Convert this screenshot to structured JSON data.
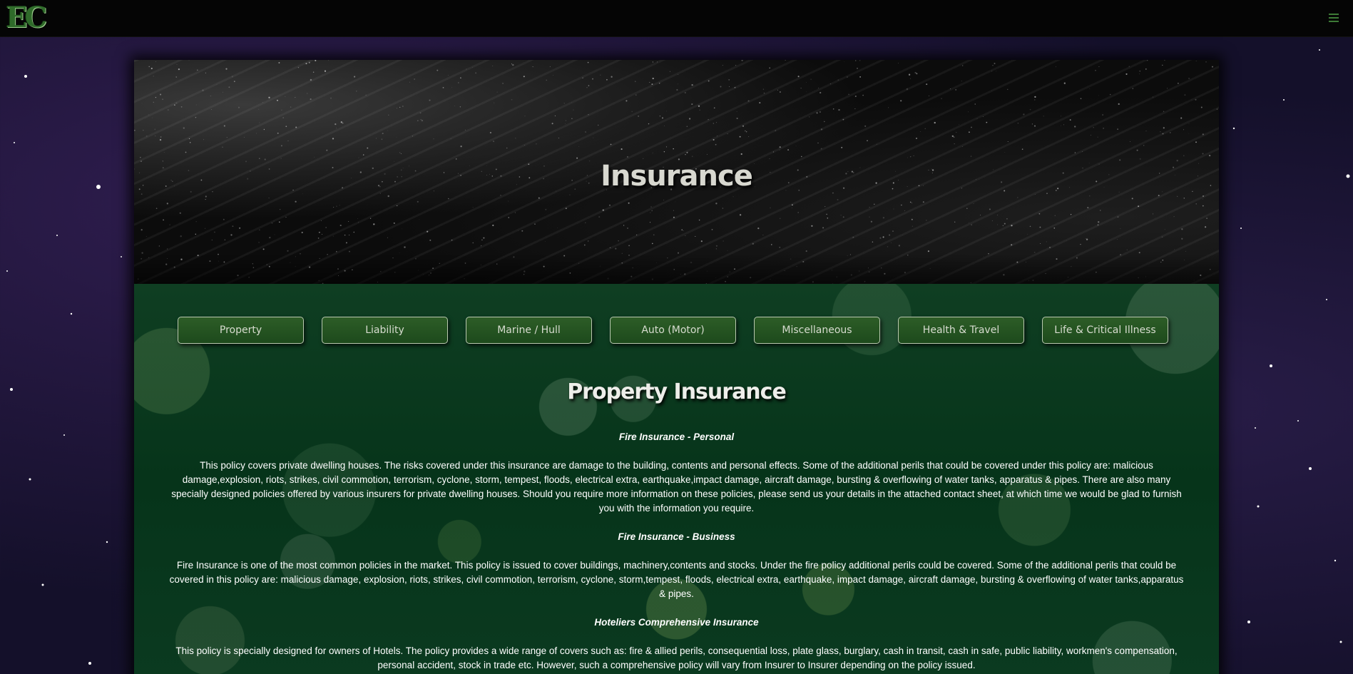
{
  "navbar": {
    "logo_text": "EC",
    "menu_icon": "hamburger-icon"
  },
  "hero": {
    "title": "Insurance"
  },
  "tabs": [
    {
      "label": "Property"
    },
    {
      "label": "Liability"
    },
    {
      "label": "Marine / Hull"
    },
    {
      "label": "Auto (Motor)"
    },
    {
      "label": "Miscellaneous"
    },
    {
      "label": "Health & Travel"
    },
    {
      "label": "Life & Critical Illness"
    }
  ],
  "section": {
    "title": "Property Insurance",
    "items": [
      {
        "heading": "Fire Insurance - Personal",
        "body": "This policy covers private dwelling houses. The risks covered under this insurance are damage to the building, contents and personal effects. Some of the additional perils that could be covered under this policy are: malicious damage,explosion, riots, strikes, civil commotion, terrorism, cyclone, storm, tempest, floods, electrical extra, earthquake,impact damage, aircraft damage, bursting & overflowing of water tanks, apparatus & pipes. There are also many specially designed policies offered by various insurers for private dwelling houses. Should you require more information on these policies, please send us your details in the attached contact sheet, at which time we would be glad to furnish you with the information you require."
      },
      {
        "heading": "Fire Insurance - Business",
        "body": "Fire Insurance is one of the most common policies in the market. This policy is issued to cover buildings, machinery,contents and stocks. Under the fire policy additional perils could be covered. Some of the additional perils that could be covered in this policy are: malicious damage, explosion, riots, strikes, civil commotion, terrorism, cyclone, storm,tempest, floods, electrical extra, earthquake, impact damage, aircraft damage, bursting & overflowing of water tanks,apparatus & pipes."
      },
      {
        "heading": "Hoteliers Comprehensive Insurance",
        "body": "This policy is specially designed for owners of Hotels. The policy provides a wide range of covers such as: fire & allied perils, consequential loss, plate glass, burglary, cash in transit, cash in safe, public liability, workmen's compensation, personal accident, stock in trade etc. However, such a comprehensive policy will vary from Insurer to Insurer depending on the policy issued."
      }
    ]
  }
}
